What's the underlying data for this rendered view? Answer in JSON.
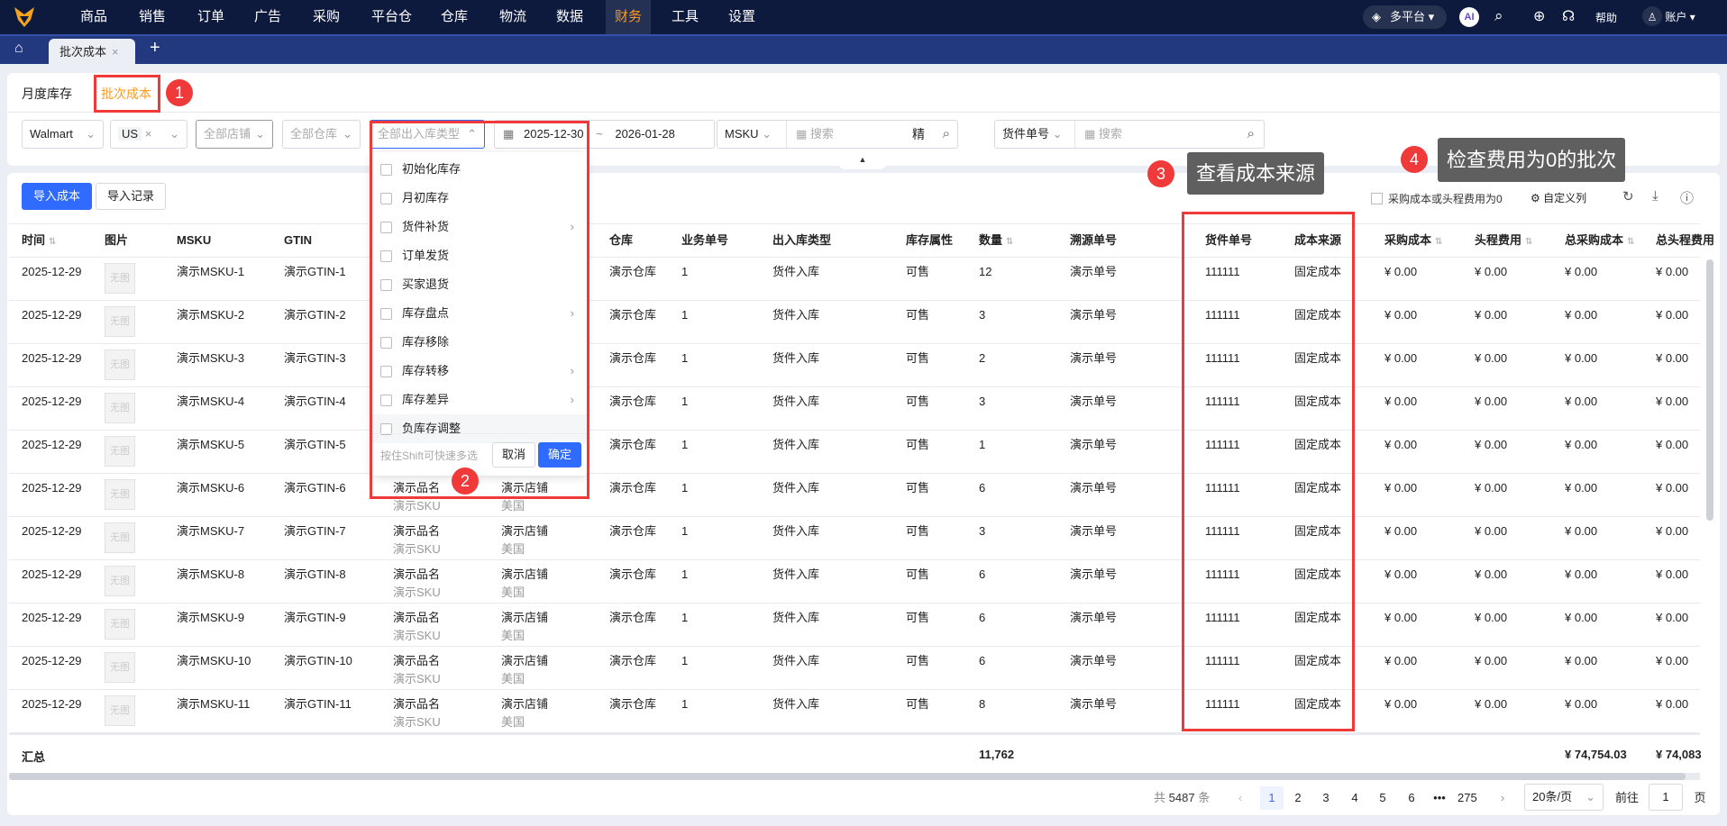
{
  "topnav": {
    "items": [
      "商品",
      "销售",
      "订单",
      "广告",
      "采购",
      "平台仓",
      "仓库",
      "物流",
      "数据",
      "财务",
      "工具",
      "设置"
    ],
    "active": "财务",
    "platform": "多平台",
    "ai": "AI",
    "help": "帮助",
    "account": "账户"
  },
  "tabs": {
    "current": "批次成本"
  },
  "subtabs": [
    "月度库存",
    "批次成本"
  ],
  "filters": {
    "platform": "Walmart",
    "country": "US",
    "store": "全部店铺",
    "warehouse": "全部仓库",
    "io_type": "全部出入库类型",
    "date_start": "2025-12-30",
    "date_sep": "~",
    "date_end": "2026-01-28",
    "search_type": "MSKU",
    "search_placeholder": "搜索",
    "exact": "精",
    "shipment_type": "货件单号",
    "shipment_placeholder": "搜索"
  },
  "dropdown": {
    "items": [
      {
        "label": "初始化库存",
        "sub": false
      },
      {
        "label": "月初库存",
        "sub": false
      },
      {
        "label": "货件补货",
        "sub": true
      },
      {
        "label": "订单发货",
        "sub": false
      },
      {
        "label": "买家退货",
        "sub": false
      },
      {
        "label": "库存盘点",
        "sub": true
      },
      {
        "label": "库存移除",
        "sub": false
      },
      {
        "label": "库存转移",
        "sub": true
      },
      {
        "label": "库存差异",
        "sub": true
      },
      {
        "label": "负库存调整",
        "sub": false
      }
    ],
    "hint": "按住Shift可快速多选",
    "cancel": "取消",
    "ok": "确定"
  },
  "toolbar": {
    "import": "导入成本",
    "records": "导入记录",
    "zero_filter": "采购成本或头程费用为0",
    "custom_cols": "自定义列"
  },
  "annotations": {
    "m1": "1",
    "m2": "2",
    "m3": "3",
    "m4": "4",
    "tip3": "查看成本来源",
    "tip4": "检查费用为0的批次"
  },
  "table": {
    "headers": [
      "时间",
      "图片",
      "MSKU",
      "GTIN",
      "",
      "",
      "仓库",
      "业务单号",
      "出入库类型",
      "库存属性",
      "数量",
      "溯源单号",
      "货件单号",
      "成本来源",
      "采购成本",
      "头程费用",
      "总采购成本",
      "总头程费用"
    ],
    "rows": [
      {
        "time": "2025-12-29",
        "img": "无图",
        "msku": "演示MSKU-1",
        "gtin": "演示GTIN-1",
        "wh": "演示仓库",
        "biz": "1",
        "io": "货件入库",
        "attr": "可售",
        "qty": "12",
        "trace": "演示单号",
        "ship": "111111",
        "src": "固定成本",
        "pc": "¥ 0.00",
        "hf": "¥ 0.00",
        "tpc": "¥ 0.00",
        "thf": "¥ 0.00"
      },
      {
        "time": "2025-12-29",
        "img": "无图",
        "msku": "演示MSKU-2",
        "gtin": "演示GTIN-2",
        "wh": "演示仓库",
        "biz": "1",
        "io": "货件入库",
        "attr": "可售",
        "qty": "3",
        "trace": "演示单号",
        "ship": "111111",
        "src": "固定成本",
        "pc": "¥ 0.00",
        "hf": "¥ 0.00",
        "tpc": "¥ 0.00",
        "thf": "¥ 0.00"
      },
      {
        "time": "2025-12-29",
        "img": "无图",
        "msku": "演示MSKU-3",
        "gtin": "演示GTIN-3",
        "wh": "演示仓库",
        "biz": "1",
        "io": "货件入库",
        "attr": "可售",
        "qty": "2",
        "trace": "演示单号",
        "ship": "111111",
        "src": "固定成本",
        "pc": "¥ 0.00",
        "hf": "¥ 0.00",
        "tpc": "¥ 0.00",
        "thf": "¥ 0.00"
      },
      {
        "time": "2025-12-29",
        "img": "无图",
        "msku": "演示MSKU-4",
        "gtin": "演示GTIN-4",
        "wh": "演示仓库",
        "biz": "1",
        "io": "货件入库",
        "attr": "可售",
        "qty": "3",
        "trace": "演示单号",
        "ship": "111111",
        "src": "固定成本",
        "pc": "¥ 0.00",
        "hf": "¥ 0.00",
        "tpc": "¥ 0.00",
        "thf": "¥ 0.00"
      },
      {
        "time": "2025-12-29",
        "img": "无图",
        "msku": "演示MSKU-5",
        "gtin": "演示GTIN-5",
        "wh": "演示仓库",
        "biz": "1",
        "io": "货件入库",
        "attr": "可售",
        "qty": "1",
        "trace": "演示单号",
        "ship": "111111",
        "src": "固定成本",
        "pc": "¥ 0.00",
        "hf": "¥ 0.00",
        "tpc": "¥ 0.00",
        "thf": "¥ 0.00"
      },
      {
        "time": "2025-12-29",
        "img": "无图",
        "msku": "演示MSKU-6",
        "gtin": "演示GTIN-6",
        "name": "演示品名",
        "sku": "演示SKU",
        "store": "演示店铺",
        "country": "美国",
        "wh": "演示仓库",
        "biz": "1",
        "io": "货件入库",
        "attr": "可售",
        "qty": "6",
        "trace": "演示单号",
        "ship": "111111",
        "src": "固定成本",
        "pc": "¥ 0.00",
        "hf": "¥ 0.00",
        "tpc": "¥ 0.00",
        "thf": "¥ 0.00"
      },
      {
        "time": "2025-12-29",
        "img": "无图",
        "msku": "演示MSKU-7",
        "gtin": "演示GTIN-7",
        "name": "演示品名",
        "sku": "演示SKU",
        "store": "演示店铺",
        "country": "美国",
        "wh": "演示仓库",
        "biz": "1",
        "io": "货件入库",
        "attr": "可售",
        "qty": "3",
        "trace": "演示单号",
        "ship": "111111",
        "src": "固定成本",
        "pc": "¥ 0.00",
        "hf": "¥ 0.00",
        "tpc": "¥ 0.00",
        "thf": "¥ 0.00"
      },
      {
        "time": "2025-12-29",
        "img": "无图",
        "msku": "演示MSKU-8",
        "gtin": "演示GTIN-8",
        "name": "演示品名",
        "sku": "演示SKU",
        "store": "演示店铺",
        "country": "美国",
        "wh": "演示仓库",
        "biz": "1",
        "io": "货件入库",
        "attr": "可售",
        "qty": "6",
        "trace": "演示单号",
        "ship": "111111",
        "src": "固定成本",
        "pc": "¥ 0.00",
        "hf": "¥ 0.00",
        "tpc": "¥ 0.00",
        "thf": "¥ 0.00"
      },
      {
        "time": "2025-12-29",
        "img": "无图",
        "msku": "演示MSKU-9",
        "gtin": "演示GTIN-9",
        "name": "演示品名",
        "sku": "演示SKU",
        "store": "演示店铺",
        "country": "美国",
        "wh": "演示仓库",
        "biz": "1",
        "io": "货件入库",
        "attr": "可售",
        "qty": "6",
        "trace": "演示单号",
        "ship": "111111",
        "src": "固定成本",
        "pc": "¥ 0.00",
        "hf": "¥ 0.00",
        "tpc": "¥ 0.00",
        "thf": "¥ 0.00"
      },
      {
        "time": "2025-12-29",
        "img": "无图",
        "msku": "演示MSKU-10",
        "gtin": "演示GTIN-10",
        "name": "演示品名",
        "sku": "演示SKU",
        "store": "演示店铺",
        "country": "美国",
        "wh": "演示仓库",
        "biz": "1",
        "io": "货件入库",
        "attr": "可售",
        "qty": "6",
        "trace": "演示单号",
        "ship": "111111",
        "src": "固定成本",
        "pc": "¥ 0.00",
        "hf": "¥ 0.00",
        "tpc": "¥ 0.00",
        "thf": "¥ 0.00"
      },
      {
        "time": "2025-12-29",
        "img": "无图",
        "msku": "演示MSKU-11",
        "gtin": "演示GTIN-11",
        "name": "演示品名",
        "sku": "演示SKU",
        "store": "演示店铺",
        "country": "美国",
        "wh": "演示仓库",
        "biz": "1",
        "io": "货件入库",
        "attr": "可售",
        "qty": "8",
        "trace": "演示单号",
        "ship": "111111",
        "src": "固定成本",
        "pc": "¥ 0.00",
        "hf": "¥ 0.00",
        "tpc": "¥ 0.00",
        "thf": "¥ 0.00"
      }
    ],
    "summary": {
      "label": "汇总",
      "qty": "11,762",
      "tpc": "¥ 74,754.03",
      "thf": "¥ 74,083"
    }
  },
  "pagination": {
    "total_prefix": "共",
    "total": "5487",
    "total_suffix": "条",
    "pages": [
      "1",
      "2",
      "3",
      "4",
      "5",
      "6",
      "•••",
      "275"
    ],
    "current": "1",
    "page_size": "20条/页",
    "goto": "前往",
    "goto_value": "1",
    "page_suffix": "页"
  }
}
